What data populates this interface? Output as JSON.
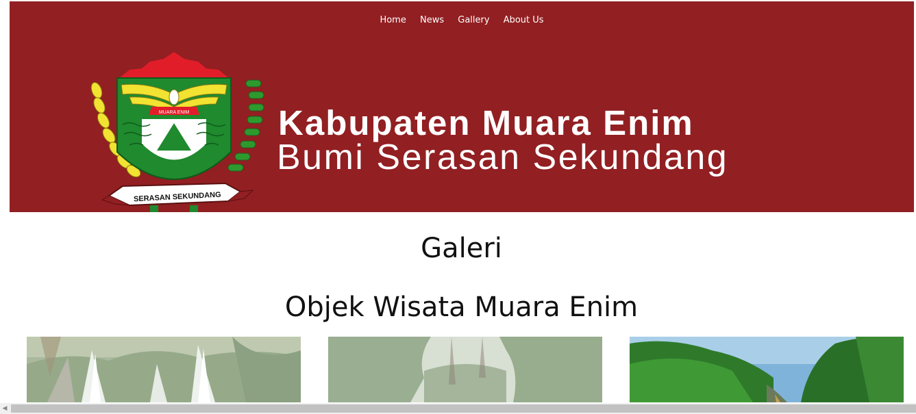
{
  "nav": {
    "items": [
      {
        "label": "Home"
      },
      {
        "label": "News"
      },
      {
        "label": "Gallery"
      },
      {
        "label": "About Us"
      }
    ]
  },
  "banner": {
    "title": "Kabupaten Muara Enim",
    "subtitle": "Bumi Serasan Sekundang",
    "emblem_top_text": "MUARA ENIM",
    "emblem_ribbon_text": "SERASAN SEKUNDANG",
    "background_color": "#921f22"
  },
  "main": {
    "page_heading": "Galeri",
    "section_heading": "Objek Wisata Muara Enim"
  },
  "gallery": {
    "photos": [
      {
        "subject": "waterfall"
      },
      {
        "subject": "forest"
      },
      {
        "subject": "green hills"
      }
    ]
  }
}
